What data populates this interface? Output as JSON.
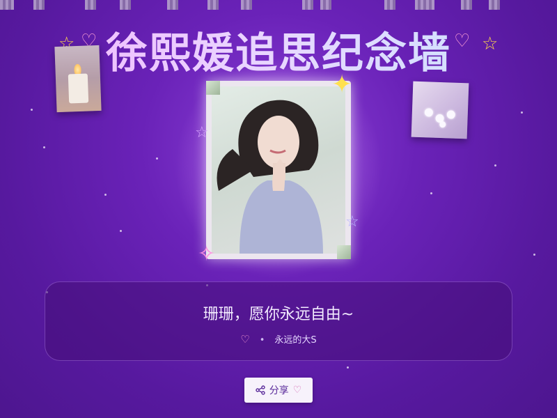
{
  "page": {
    "title": "徐熙媛追思纪念墙"
  },
  "tribute": {
    "message": "珊珊，愿你永远自由~",
    "like_icon": "heart-icon",
    "separator": "•",
    "author": "永远的大S"
  },
  "actions": {
    "share_label": "分享",
    "share_icon": "share-icon",
    "share_heart_icon": "heart-icon"
  },
  "colors": {
    "background": "#6a22b8",
    "accent_pink": "#ff9fd6",
    "accent_gold": "#ffd84a",
    "card": "#46107a"
  }
}
